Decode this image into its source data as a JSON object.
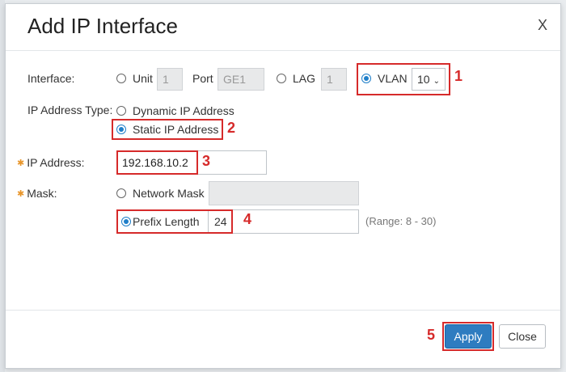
{
  "dialog": {
    "title": "Add IP Interface",
    "close_label": "X"
  },
  "interface": {
    "label": "Interface:",
    "unit_label": "Unit",
    "unit_value": "1",
    "port_label": "Port",
    "port_value": "GE1",
    "lag_label": "LAG",
    "lag_value": "1",
    "vlan_label": "VLAN",
    "vlan_value": "10",
    "selected": "VLAN"
  },
  "ip_type": {
    "label": "IP Address Type:",
    "dynamic_label": "Dynamic IP Address",
    "static_label": "Static IP Address",
    "selected": "Static IP Address"
  },
  "ip_address": {
    "label": "IP Address:",
    "value": "192.168.10.2"
  },
  "mask": {
    "label": "Mask:",
    "network_mask_label": "Network Mask",
    "network_mask_value": "",
    "prefix_label": "Prefix Length",
    "prefix_value": "24",
    "range_hint": "(Range: 8 - 30)",
    "selected": "Prefix Length"
  },
  "annotations": {
    "n1": "1",
    "n2": "2",
    "n3": "3",
    "n4": "4",
    "n5": "5"
  },
  "buttons": {
    "apply": "Apply",
    "close": "Close"
  },
  "colors": {
    "accent": "#2e7cc0",
    "annotation": "#d62a2a",
    "required": "#e8962b"
  }
}
